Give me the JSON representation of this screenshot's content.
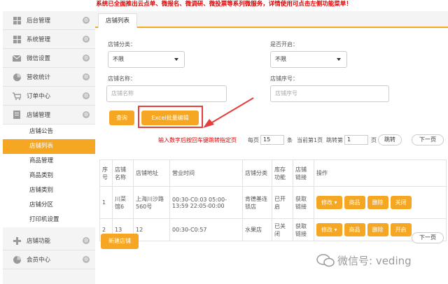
{
  "banner": "系统已全面推出云点单、微报名、微调研、微投票等系列微服务，详情使用可点击左侧功能菜单！",
  "sidebar": {
    "top_items": [
      {
        "label": "后台管理"
      },
      {
        "label": "系统管理"
      },
      {
        "label": "微信设置"
      },
      {
        "label": "营收统计"
      },
      {
        "label": "订单中心"
      },
      {
        "label": "店铺管理"
      }
    ],
    "sub_items": [
      {
        "label": "店铺公告"
      },
      {
        "label": "店铺列表"
      },
      {
        "label": "商品管理"
      },
      {
        "label": "商品类别"
      },
      {
        "label": "店铺类别"
      },
      {
        "label": "店铺分区"
      },
      {
        "label": "打印机设置"
      }
    ],
    "bottom_items": [
      {
        "label": "店铺功能"
      },
      {
        "label": "会员中心"
      }
    ]
  },
  "tab": {
    "label": "店铺列表"
  },
  "filters": {
    "category_label": "店铺分类：",
    "category_value": "不限",
    "open_label": "是否开启：",
    "open_value": "不限",
    "name_label": "店铺名称：",
    "name_placeholder": "店铺名称",
    "order_label": "店铺序号：",
    "order_placeholder": "店铺序号"
  },
  "actions": {
    "search": "查询",
    "excel": "Excel批量编辑"
  },
  "pager": {
    "hint": "输入数字后按回车键跳转指定页",
    "per_page_prefix": "每页",
    "per_page_value": "15",
    "per_page_suffix": "条",
    "current": "当前第1页",
    "jump_prefix": "跳转第",
    "jump_value": "1",
    "jump_suffix": "页",
    "jump_btn": "跳转",
    "next": "下一页"
  },
  "table": {
    "headers": [
      "序号",
      "店铺名称",
      "店铺地址",
      "营业时间",
      "店铺分类",
      "库存功能",
      "店铺链接",
      "操作"
    ],
    "rows": [
      {
        "id": "1",
        "name": "川菜馆6",
        "address": "上海川沙路560号",
        "hours": "00:30-C0:03 05:00-13:59 22:05-00:00",
        "category": "肯德基连锁店",
        "stock": "已开启",
        "link": "获取链接",
        "btns": [
          "修改 ▾",
          "商品",
          "删除",
          "关闭"
        ]
      },
      {
        "id": "2",
        "name": "13",
        "address": "12",
        "hours": "00:30-C0:57",
        "category": "水果店",
        "stock": "已关闭",
        "link": "获取链接",
        "btns": [
          "修改 ▾",
          "商品",
          "删除",
          "开启"
        ]
      }
    ]
  },
  "new_store": "新建店铺",
  "bottom_next": "下一页",
  "watermark": "微信号: veding",
  "colors": {
    "accent": "#f5a623",
    "alert": "#e00000",
    "link": "#2a8aa5"
  }
}
